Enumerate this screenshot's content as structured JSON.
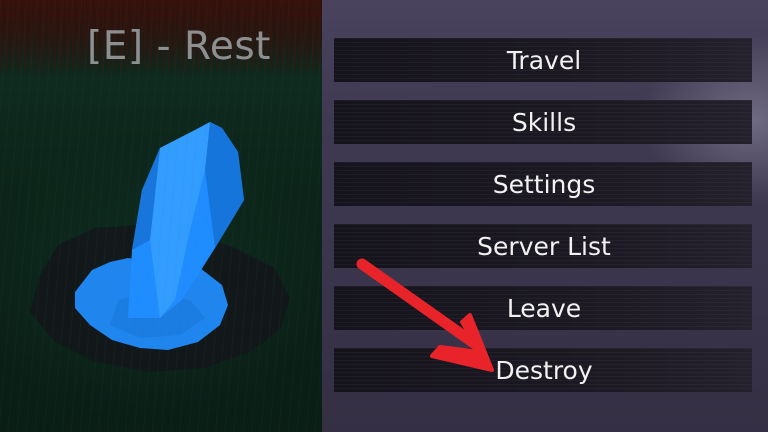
{
  "prompt": {
    "rest_text": "[E] - Rest"
  },
  "menu": {
    "items": [
      {
        "label": "Travel"
      },
      {
        "label": "Skills"
      },
      {
        "label": "Settings"
      },
      {
        "label": "Server List"
      },
      {
        "label": "Leave"
      },
      {
        "label": "Destroy"
      }
    ]
  },
  "annotation": {
    "arrow_color": "#e8232a",
    "points_to": "Destroy"
  },
  "colors": {
    "crystal": "#1f8dff",
    "panel": "#3f3952",
    "button": "#1b1822",
    "prompt_text": "#8d8f91"
  }
}
